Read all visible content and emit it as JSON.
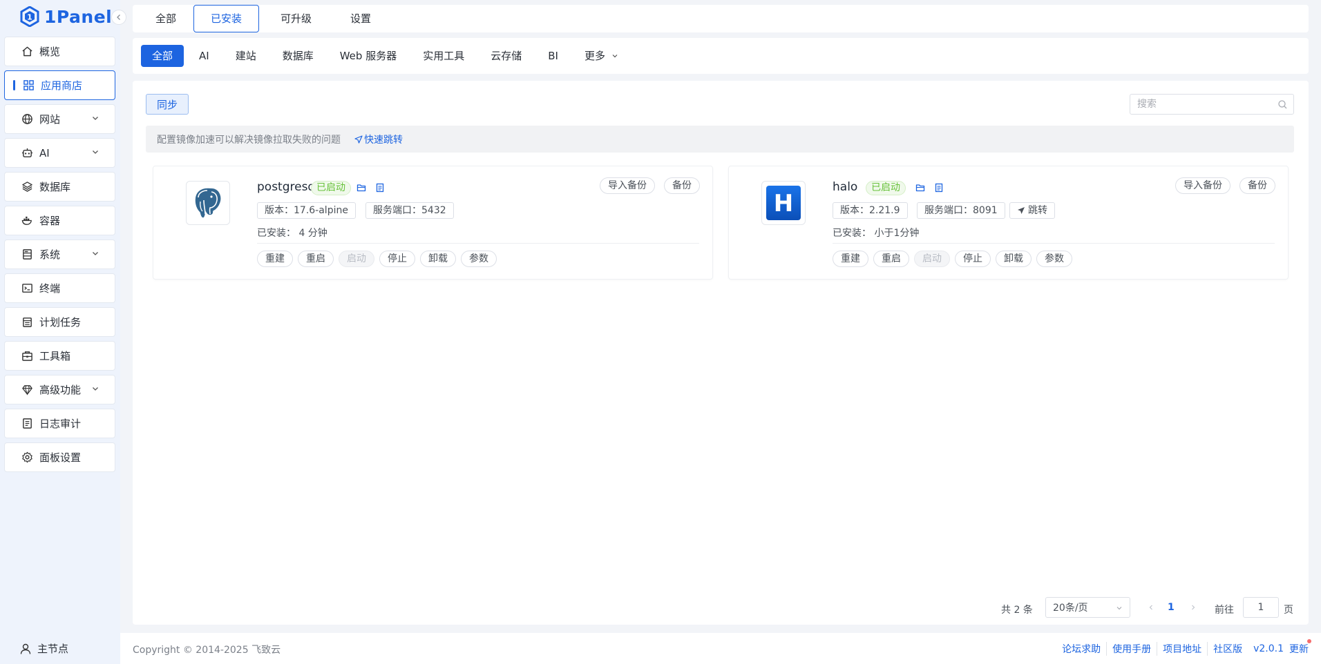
{
  "brand": {
    "name": "1Panel",
    "color": "#1d64e0"
  },
  "sidebar": {
    "items": [
      {
        "label": "概览",
        "icon": "home-icon",
        "expandable": false,
        "active": false
      },
      {
        "label": "应用商店",
        "icon": "grid-icon",
        "expandable": false,
        "active": true
      },
      {
        "label": "网站",
        "icon": "globe-icon",
        "expandable": true,
        "active": false
      },
      {
        "label": "AI",
        "icon": "robot-icon",
        "expandable": true,
        "active": false
      },
      {
        "label": "数据库",
        "icon": "layers-icon",
        "expandable": false,
        "active": false
      },
      {
        "label": "容器",
        "icon": "docker-icon",
        "expandable": false,
        "active": false
      },
      {
        "label": "系统",
        "icon": "server-icon",
        "expandable": true,
        "active": false
      },
      {
        "label": "终端",
        "icon": "terminal-icon",
        "expandable": false,
        "active": false
      },
      {
        "label": "计划任务",
        "icon": "calendar-icon",
        "expandable": false,
        "active": false
      },
      {
        "label": "工具箱",
        "icon": "toolbox-icon",
        "expandable": false,
        "active": false
      },
      {
        "label": "高级功能",
        "icon": "diamond-icon",
        "expandable": true,
        "active": false
      },
      {
        "label": "日志审计",
        "icon": "log-icon",
        "expandable": false,
        "active": false
      },
      {
        "label": "面板设置",
        "icon": "gear-icon",
        "expandable": false,
        "active": false
      }
    ],
    "footer_label": "主节点"
  },
  "top_tabs": [
    {
      "label": "全部",
      "active": false
    },
    {
      "label": "已安装",
      "active": true
    },
    {
      "label": "可升级",
      "active": false
    },
    {
      "label": "设置",
      "active": false
    }
  ],
  "categories": [
    {
      "label": "全部",
      "active": true
    },
    {
      "label": "AI",
      "active": false
    },
    {
      "label": "建站",
      "active": false
    },
    {
      "label": "数据库",
      "active": false
    },
    {
      "label": "Web 服务器",
      "active": false
    },
    {
      "label": "实用工具",
      "active": false
    },
    {
      "label": "云存储",
      "active": false
    },
    {
      "label": "BI",
      "active": false
    },
    {
      "label": "更多",
      "active": false
    }
  ],
  "toolbar": {
    "sync_label": "同步",
    "search_placeholder": "搜索"
  },
  "notice": {
    "text": "配置镜像加速可以解决镜像拉取失败的问题",
    "link": "快速跳转"
  },
  "apps": [
    {
      "name": "postgresql",
      "status": "已启动",
      "version_tag": "版本：17.6-alpine",
      "port_tag": "服务端口：5432",
      "installed": "已安装：  4 分钟",
      "import_backup": "导入备份",
      "backup": "备份",
      "actions": {
        "rebuild": "重建",
        "restart": "重启",
        "start": "启动",
        "stop": "停止",
        "uninstall": "卸载",
        "params": "参数"
      }
    },
    {
      "name": "halo",
      "status": "已启动",
      "version_tag": "版本：2.21.9",
      "port_tag": "服务端口：8091",
      "jump_tag": "跳转",
      "installed": "已安装：  小于1分钟",
      "import_backup": "导入备份",
      "backup": "备份",
      "actions": {
        "rebuild": "重建",
        "restart": "重启",
        "start": "启动",
        "stop": "停止",
        "uninstall": "卸载",
        "params": "参数"
      }
    }
  ],
  "pagination": {
    "total": "共 2 条",
    "page_size": "20条/页",
    "current_page": "1",
    "goto_label": "前往",
    "goto_value": "1",
    "unit": "页"
  },
  "footer": {
    "copyright": "Copyright © 2014-2025 飞致云",
    "links": [
      "论坛求助",
      "使用手册",
      "项目地址",
      "社区版"
    ],
    "version": "v2.0.1",
    "update": "更新"
  }
}
